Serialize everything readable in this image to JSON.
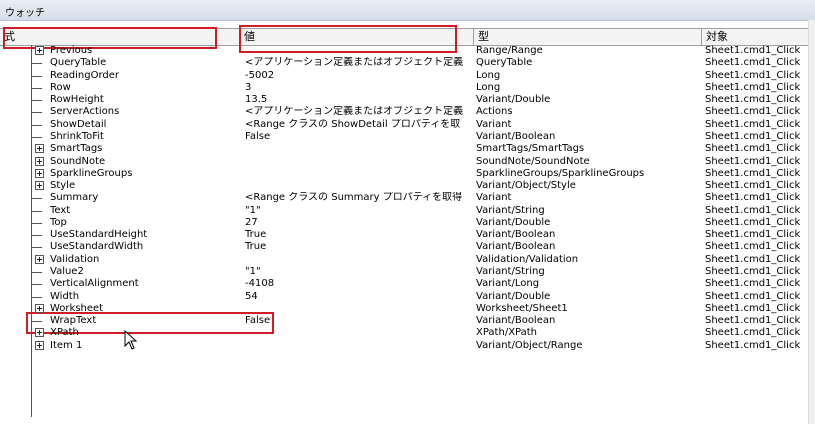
{
  "window": {
    "title": "ウォッチ"
  },
  "columns": {
    "expr": "式",
    "value": "値",
    "type": "型",
    "context": "対象"
  },
  "rows": [
    {
      "expr": "Previous",
      "value": "",
      "type": "Range/Range",
      "context": "Sheet1.cmd1_Click",
      "expandable": true
    },
    {
      "expr": "QueryTable",
      "value": "<アプリケーション定義またはオブジェクト定義",
      "type": "QueryTable",
      "context": "Sheet1.cmd1_Click",
      "expandable": false
    },
    {
      "expr": "ReadingOrder",
      "value": "-5002",
      "type": "Long",
      "context": "Sheet1.cmd1_Click",
      "expandable": false
    },
    {
      "expr": "Row",
      "value": "3",
      "type": "Long",
      "context": "Sheet1.cmd1_Click",
      "expandable": false
    },
    {
      "expr": "RowHeight",
      "value": "13.5",
      "type": "Variant/Double",
      "context": "Sheet1.cmd1_Click",
      "expandable": false
    },
    {
      "expr": "ServerActions",
      "value": "<アプリケーション定義またはオブジェクト定義",
      "type": "Actions",
      "context": "Sheet1.cmd1_Click",
      "expandable": false
    },
    {
      "expr": "ShowDetail",
      "value": "<Range クラスの ShowDetail プロパティを取",
      "type": "Variant",
      "context": "Sheet1.cmd1_Click",
      "expandable": false
    },
    {
      "expr": "ShrinkToFit",
      "value": "False",
      "type": "Variant/Boolean",
      "context": "Sheet1.cmd1_Click",
      "expandable": false
    },
    {
      "expr": "SmartTags",
      "value": "",
      "type": "SmartTags/SmartTags",
      "context": "Sheet1.cmd1_Click",
      "expandable": true
    },
    {
      "expr": "SoundNote",
      "value": "",
      "type": "SoundNote/SoundNote",
      "context": "Sheet1.cmd1_Click",
      "expandable": true
    },
    {
      "expr": "SparklineGroups",
      "value": "",
      "type": "SparklineGroups/SparklineGroups",
      "context": "Sheet1.cmd1_Click",
      "expandable": true
    },
    {
      "expr": "Style",
      "value": "",
      "type": "Variant/Object/Style",
      "context": "Sheet1.cmd1_Click",
      "expandable": true
    },
    {
      "expr": "Summary",
      "value": "<Range クラスの Summary プロパティを取得",
      "type": "Variant",
      "context": "Sheet1.cmd1_Click",
      "expandable": false
    },
    {
      "expr": "Text",
      "value": "\"1\"",
      "type": "Variant/String",
      "context": "Sheet1.cmd1_Click",
      "expandable": false
    },
    {
      "expr": "Top",
      "value": "27",
      "type": "Variant/Double",
      "context": "Sheet1.cmd1_Click",
      "expandable": false
    },
    {
      "expr": "UseStandardHeight",
      "value": "True",
      "type": "Variant/Boolean",
      "context": "Sheet1.cmd1_Click",
      "expandable": false
    },
    {
      "expr": "UseStandardWidth",
      "value": "True",
      "type": "Variant/Boolean",
      "context": "Sheet1.cmd1_Click",
      "expandable": false
    },
    {
      "expr": "Validation",
      "value": "",
      "type": "Validation/Validation",
      "context": "Sheet1.cmd1_Click",
      "expandable": true
    },
    {
      "expr": "Value2",
      "value": "\"1\"",
      "type": "Variant/String",
      "context": "Sheet1.cmd1_Click",
      "expandable": false
    },
    {
      "expr": "VerticalAlignment",
      "value": "-4108",
      "type": "Variant/Long",
      "context": "Sheet1.cmd1_Click",
      "expandable": false
    },
    {
      "expr": "Width",
      "value": "54",
      "type": "Variant/Double",
      "context": "Sheet1.cmd1_Click",
      "expandable": false
    },
    {
      "expr": "Worksheet",
      "value": "",
      "type": "Worksheet/Sheet1",
      "context": "Sheet1.cmd1_Click",
      "expandable": true
    },
    {
      "expr": "WrapText",
      "value": "False",
      "type": "Variant/Boolean",
      "context": "Sheet1.cmd1_Click",
      "expandable": false
    },
    {
      "expr": "XPath",
      "value": "",
      "type": "XPath/XPath",
      "context": "Sheet1.cmd1_Click",
      "expandable": true
    },
    {
      "expr": "Item 1",
      "value": "",
      "type": "Variant/Object/Range",
      "context": "Sheet1.cmd1_Click",
      "expandable": true
    }
  ],
  "colors": {
    "highlight": "#d01c24",
    "header_bg": "#f4f4f4"
  }
}
